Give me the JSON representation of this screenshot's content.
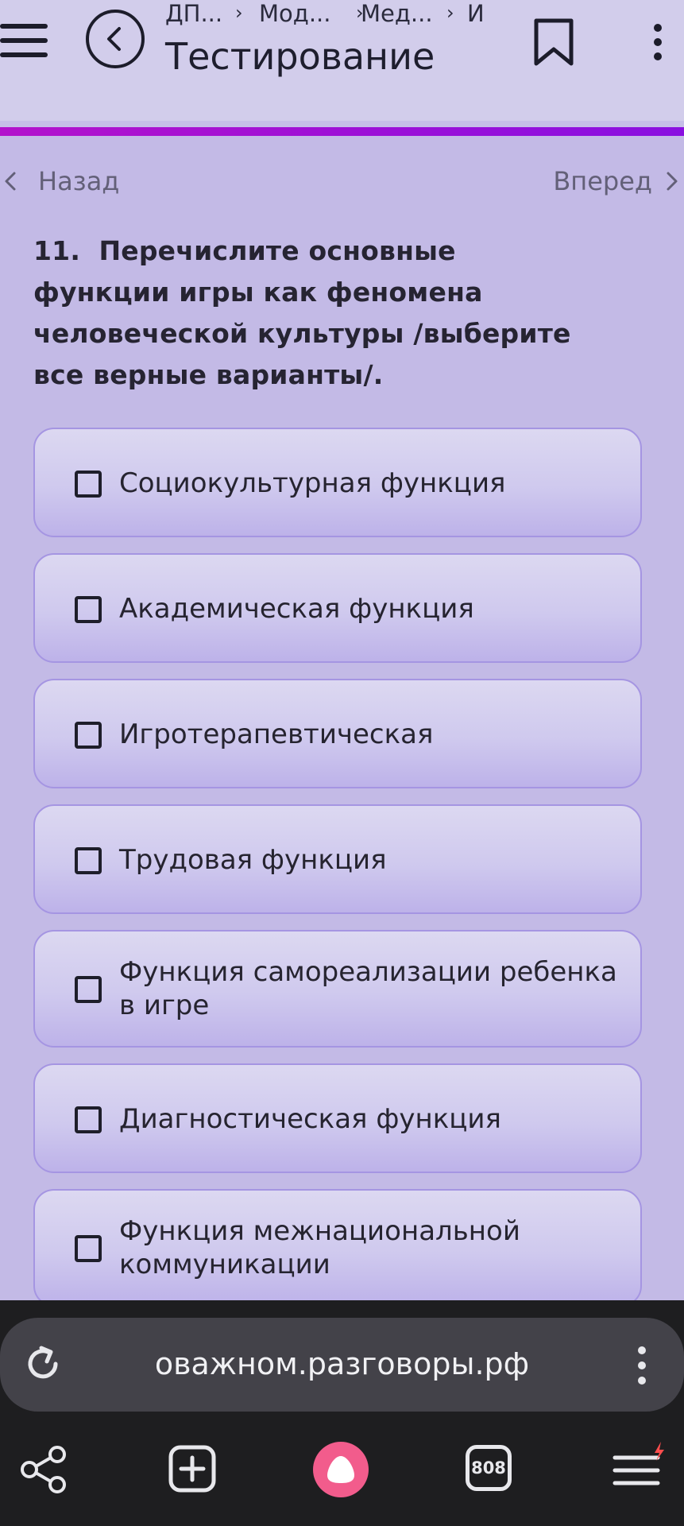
{
  "header": {
    "breadcrumbs": [
      "ДП...",
      "Мод...",
      "Мед...",
      "И"
    ],
    "title": "Тестирование"
  },
  "nav": {
    "prev_label": "Назад",
    "next_label": "Вперед"
  },
  "question": {
    "number": "11.",
    "text": "Перечислите основные функции игры как феномена человеческой культуры /выберите все верные варианты/."
  },
  "options": [
    {
      "label": "Социокультурная функция",
      "checked": false
    },
    {
      "label": "Академическая функция",
      "checked": false
    },
    {
      "label": "Игротерапевтическая",
      "checked": false
    },
    {
      "label": "Трудовая функция",
      "checked": false
    },
    {
      "label": "Функция самореализации ребенка в игре",
      "checked": false
    },
    {
      "label": "Диагностическая функция",
      "checked": false
    },
    {
      "label": "Функция межнациональной коммуникации",
      "checked": false
    }
  ],
  "browser": {
    "url": "оважном.разговоры.рф",
    "tab_count": "808"
  },
  "colors": {
    "accent_line": "#9a10d8",
    "page_bg": "#c3bae6",
    "alice_button": "#f25c8c"
  }
}
